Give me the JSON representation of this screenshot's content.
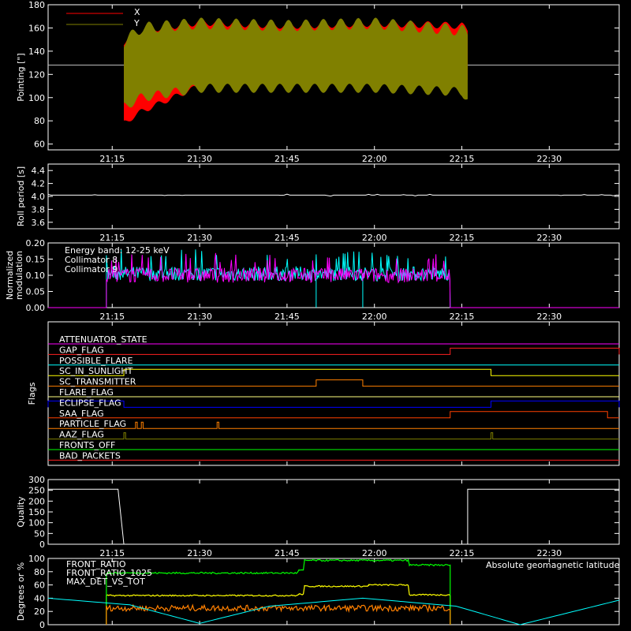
{
  "time_ticks": [
    "21:15",
    "21:30",
    "21:45",
    "22:00",
    "22:15",
    "22:30"
  ],
  "chart_data": [
    {
      "type": "line",
      "panel": "pointing",
      "ylabel": "Pointing [\"]",
      "ylim": [
        55,
        180
      ],
      "yticks": [
        "60",
        "80",
        "100",
        "120",
        "140",
        "160",
        "180"
      ],
      "legend": [
        "X",
        "Y"
      ],
      "colors": {
        "X": "#ff0000",
        "Y": "#808000",
        "baseline": "#bbbbbb"
      },
      "baseline": 128,
      "time_range": [
        "21:17",
        "22:16"
      ],
      "series": [
        {
          "name": "X",
          "x": [
            "21:17",
            "21:20",
            "21:30",
            "21:45",
            "22:00",
            "22:15",
            "22:16"
          ],
          "min": [
            78,
            88,
            110,
            110,
            110,
            115,
            115
          ],
          "max": [
            148,
            158,
            165,
            162,
            164,
            162,
            158
          ]
        },
        {
          "name": "Y",
          "x": [
            "21:17",
            "21:20",
            "21:30",
            "21:45",
            "22:00",
            "22:15",
            "22:16"
          ],
          "min": [
            92,
            100,
            108,
            108,
            108,
            105,
            98
          ],
          "max": [
            148,
            160,
            164,
            162,
            164,
            158,
            155
          ]
        }
      ]
    },
    {
      "type": "line",
      "panel": "roll",
      "ylabel": "Roll period [s]",
      "ylim": [
        3.5,
        4.5
      ],
      "yticks": [
        "3.6",
        "3.8",
        "4.0",
        "4.2",
        "4.4"
      ],
      "value": 4.02
    },
    {
      "type": "line",
      "panel": "modulation",
      "ylabel": "Normalized modulation",
      "ylim": [
        0,
        0.2
      ],
      "yticks": [
        "0.00",
        "0.05",
        "0.10",
        "0.15",
        "0.20"
      ],
      "annotation": "Energy band: 12-25 keV",
      "legend": [
        "Collimator 8",
        "Collimator 9"
      ],
      "colors": {
        "Collimator 8": "#00ffff",
        "Collimator 9": "#ff00ff"
      },
      "time_range": [
        "21:14",
        "22:13"
      ],
      "typical": 0.1,
      "series": [
        {
          "name": "Collimator 8",
          "mean": 0.105,
          "peak": 0.18
        },
        {
          "name": "Collimator 9",
          "mean": 0.1,
          "peak": 0.17
        }
      ]
    },
    {
      "type": "line",
      "panel": "flags",
      "ylabel": "Flags",
      "flags": [
        {
          "name": "ATTENUATOR_STATE",
          "color": "#ff00ff",
          "segments": []
        },
        {
          "name": "GAP_FLAG",
          "color": "#ff2020",
          "segments": [
            [
              "21:16",
              "22:13"
            ]
          ],
          "high": [
            "22:13",
            "22:42"
          ]
        },
        {
          "name": "POSSIBLE_FLARE",
          "color": "#00ffff",
          "segments": []
        },
        {
          "name": "SC_IN_SUNLIGHT",
          "color": "#ffff00",
          "high": [
            "21:17",
            "22:20"
          ]
        },
        {
          "name": "SC_TRANSMITTER",
          "color": "#ff8000",
          "high": [
            "21:50",
            "21:58"
          ]
        },
        {
          "name": "FLARE_FLAG",
          "color": "#ffff80",
          "segments": []
        },
        {
          "name": "ECLIPSE_FLAG",
          "color": "#0000ff",
          "high": [
            "21:04",
            "21:17",
            "22:20",
            "22:42"
          ]
        },
        {
          "name": "SAA_FLAG",
          "color": "#ff4000",
          "high": [
            "22:13",
            "22:40"
          ]
        },
        {
          "name": "PARTICLE_FLAG",
          "color": "#ff8000",
          "spikes": [
            "21:19",
            "21:20",
            "21:33"
          ]
        },
        {
          "name": "AAZ_FLAG",
          "color": "#808000",
          "spikes": [
            "21:17",
            "22:20"
          ]
        },
        {
          "name": "FRONTS_OFF",
          "color": "#00ff00",
          "segments": []
        },
        {
          "name": "BAD_PACKETS",
          "color": "#ff2020",
          "segments": []
        }
      ]
    },
    {
      "type": "line",
      "panel": "quality",
      "ylabel": "Quality",
      "ylim": [
        0,
        300
      ],
      "yticks": [
        "0",
        "50",
        "100",
        "150",
        "200",
        "250",
        "300"
      ],
      "segments": [
        {
          "x": [
            "21:04",
            "21:16"
          ],
          "y": 255
        },
        {
          "x": [
            "21:17",
            "22:16"
          ],
          "y": 0
        },
        {
          "x": [
            "22:16",
            "22:42"
          ],
          "y": 255
        }
      ]
    },
    {
      "type": "line",
      "panel": "ratios",
      "ylabel": "Degrees or %",
      "ylim": [
        0,
        100
      ],
      "yticks": [
        "0",
        "20",
        "40",
        "60",
        "80",
        "100"
      ],
      "legend": [
        "FRONT_RATIO",
        "FRONT_RATIO_1025",
        "MAX_DET_VS_TOT",
        "Absolute geomagnetic latitude"
      ],
      "colors": {
        "FRONT_RATIO": "#ffff00",
        "FRONT_RATIO_1025": "#00ff00",
        "MAX_DET_VS_TOT": "#ff8000",
        "Absolute geomagnetic latitude": "#00ffff"
      },
      "series": [
        {
          "name": "FRONT_RATIO",
          "x": [
            "21:14",
            "21:47",
            "21:48",
            "21:59",
            "22:06",
            "22:13"
          ],
          "y": [
            44,
            46,
            58,
            60,
            45,
            44
          ]
        },
        {
          "name": "FRONT_RATIO_1025",
          "x": [
            "21:14",
            "21:47",
            "21:48",
            "22:06",
            "22:13"
          ],
          "y": [
            78,
            82,
            97,
            90,
            90
          ]
        },
        {
          "name": "MAX_DET_VS_TOT",
          "x": [
            "21:14",
            "22:13"
          ],
          "y": [
            25,
            22
          ]
        },
        {
          "name": "Absolute geomagnetic latitude",
          "x": [
            "21:04",
            "21:18",
            "21:30",
            "21:42",
            "21:58",
            "22:14",
            "22:25",
            "22:42"
          ],
          "y": [
            40,
            30,
            2,
            28,
            40,
            28,
            0,
            37
          ]
        }
      ]
    }
  ]
}
